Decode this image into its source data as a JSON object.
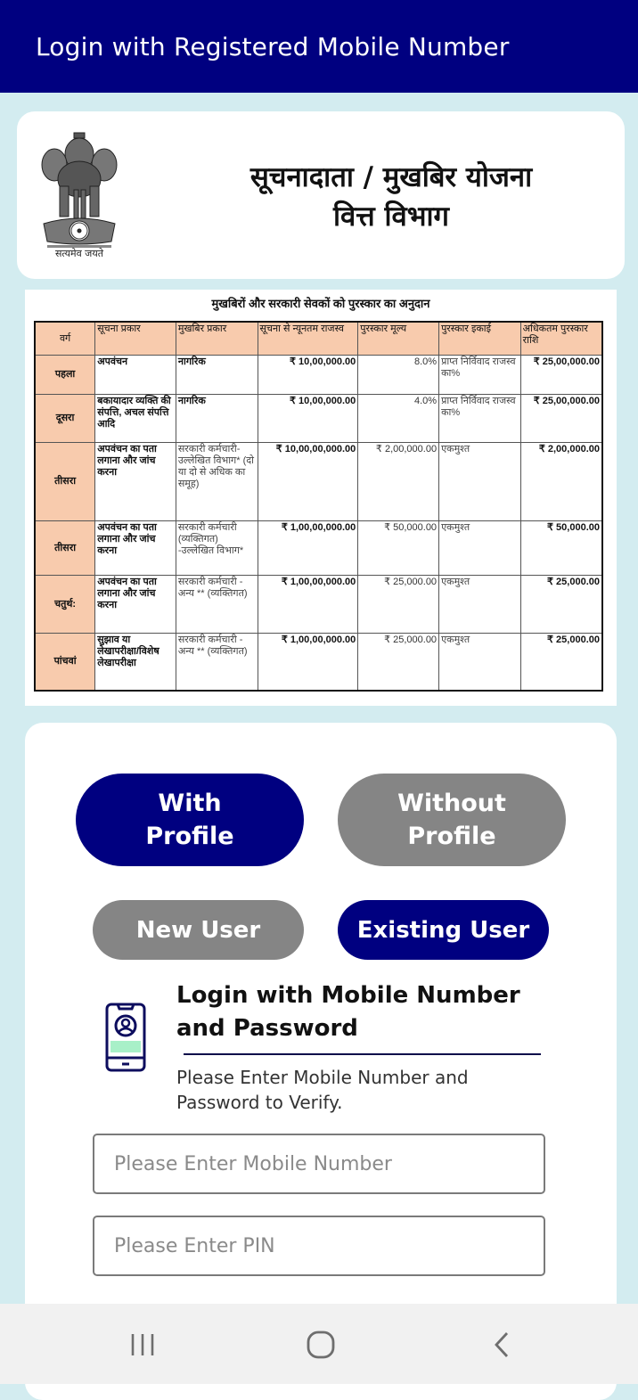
{
  "appbar": {
    "title": "Login with Registered Mobile Number"
  },
  "header": {
    "emblem_icon": "national-emblem-icon",
    "emblem_motto": "सत्यमेव जयते",
    "scheme_title_line1": "सूचनादाता / मुखबिर योजना",
    "scheme_title_line2": "वित्त विभाग"
  },
  "rewards_table": {
    "title": "मुखबिरों और सरकारी सेवकों को पुरस्कार का अनुदान",
    "columns": [
      "वर्ग",
      "सूचना प्रकार",
      "मुखबिर प्रकार",
      "सूचना से न्यूनतम राजस्व",
      "पुरस्कार मूल्य",
      "पुरस्कार इकाई",
      "अधिकतम पुरस्कार राशि"
    ],
    "rows": [
      {
        "category": "पहला",
        "info_type": "अपवंचन",
        "informer_type": "नागरिक",
        "min_revenue": "₹ 10,00,000.00",
        "reward_value": "8.0%",
        "reward_unit": "प्राप्त निर्विवाद राजस्व का%",
        "max_reward": "₹ 25,00,000.00"
      },
      {
        "category": "दूसरा",
        "info_type": "बकायादार व्यक्ति की संपत्ति, अचल संपत्ति आदि",
        "informer_type": "नागरिक",
        "min_revenue": "₹ 10,00,000.00",
        "reward_value": "4.0%",
        "reward_unit": "प्राप्त निर्विवाद राजस्व का%",
        "max_reward": "₹ 25,00,000.00"
      },
      {
        "category": "तीसरा",
        "info_type": "अपवंचन का पता लगाना और जांच करना",
        "informer_type": "सरकारी कर्मचारी- उल्लेखित विभाग* (दो या दो से अधिक का समूह)",
        "min_revenue": "₹ 10,00,00,000.00",
        "reward_value": "₹ 2,00,000.00",
        "reward_unit": "एकमुश्त",
        "max_reward": "₹ 2,00,000.00"
      },
      {
        "category": "तीसरा",
        "info_type": "अपवंचन का पता लगाना और जांच करना",
        "informer_type": "सरकारी कर्मचारी (व्यक्तिगत) -उल्लेखित विभाग*",
        "min_revenue": "₹ 1,00,00,000.00",
        "reward_value": "₹ 50,000.00",
        "reward_unit": "एकमुश्त",
        "max_reward": "₹ 50,000.00"
      },
      {
        "category": "चतुर्थ:",
        "info_type": "अपवंचन का पता लगाना और जांच करना",
        "informer_type": "सरकारी कर्मचारी - अन्य ** (व्यक्तिगत)",
        "min_revenue": "₹ 1,00,00,000.00",
        "reward_value": "₹ 25,000.00",
        "reward_unit": "एकमुश्त",
        "max_reward": "₹ 25,000.00"
      },
      {
        "category": "पांचवां",
        "info_type": "सुझाव या लेखापरीक्षा/विशेष लेखापरीक्षा",
        "informer_type": "सरकारी कर्मचारी - अन्य ** (व्यक्तिगत)",
        "min_revenue": "₹ 1,00,00,000.00",
        "reward_value": "₹ 25,000.00",
        "reward_unit": "एकमुश्त",
        "max_reward": "₹ 25,000.00"
      }
    ]
  },
  "login": {
    "profile_toggle": {
      "with_profile": "With Profile",
      "without_profile": "Without Profile",
      "selected": "with_profile"
    },
    "user_toggle": {
      "new_user": "New User",
      "existing_user": "Existing User",
      "selected": "existing_user"
    },
    "heading": "Login with Mobile Number and Password",
    "subtext": "Please Enter Mobile Number and Password to Verify.",
    "mobile_field": {
      "value": "",
      "placeholder": "Please Enter Mobile Number"
    },
    "pin_field": {
      "value": "",
      "placeholder": "Please Enter PIN"
    }
  },
  "colors": {
    "primary": "#000080",
    "inactive": "#858585",
    "background": "#d3ecf0",
    "table_header": "#f8cbad",
    "icon_accent": "#a8f0c8"
  },
  "navbar": {
    "recent_apps_icon": "recent-apps-icon",
    "home_icon": "home-icon",
    "back_icon": "back-icon"
  }
}
